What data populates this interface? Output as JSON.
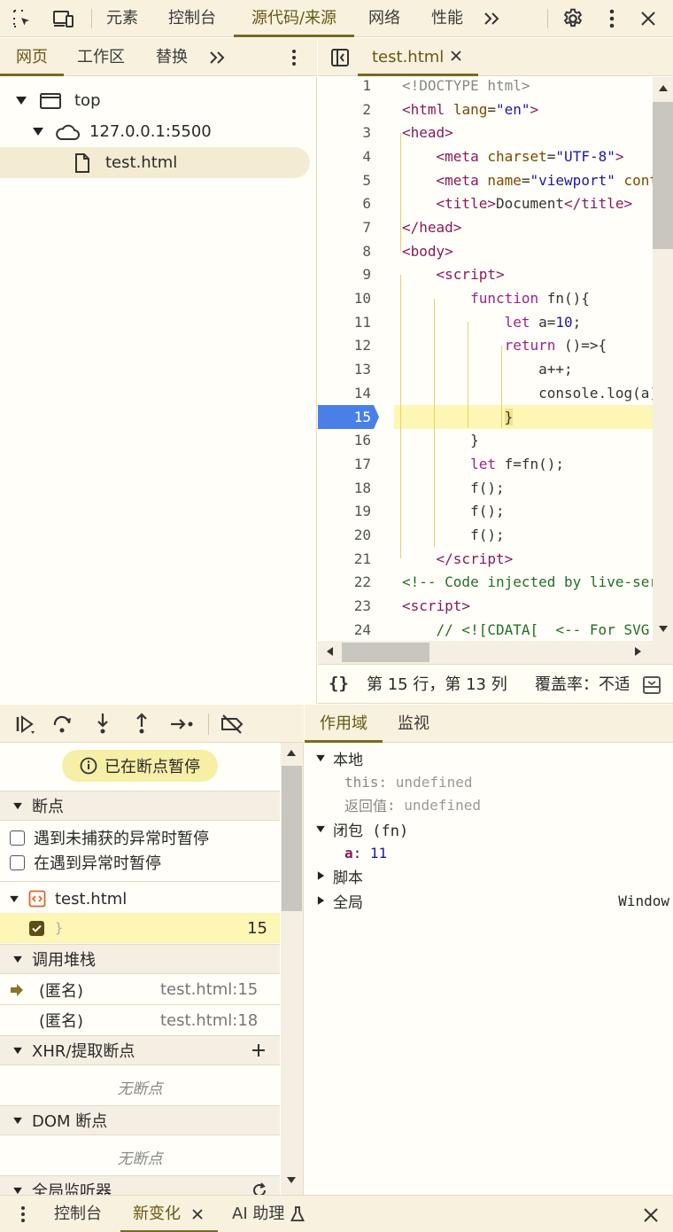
{
  "top_tabs": {
    "elements": "元素",
    "console": "控制台",
    "sources": "源代码/来源",
    "network": "网络",
    "performance": "性能"
  },
  "navigator": {
    "tabs": [
      "网页",
      "工作区",
      "替换"
    ],
    "tree": {
      "top": "top",
      "host": "127.0.0.1:5500",
      "file": "test.html"
    }
  },
  "editor": {
    "tab_label": "test.html",
    "lines": [
      {
        "n": "1"
      },
      {
        "n": "2"
      },
      {
        "n": "3"
      },
      {
        "n": "4"
      },
      {
        "n": "5"
      },
      {
        "n": "6"
      },
      {
        "n": "7"
      },
      {
        "n": "8"
      },
      {
        "n": "9"
      },
      {
        "n": "10"
      },
      {
        "n": "11"
      },
      {
        "n": "12"
      },
      {
        "n": "13"
      },
      {
        "n": "14"
      },
      {
        "n": "15"
      },
      {
        "n": "16"
      },
      {
        "n": "17"
      },
      {
        "n": "18"
      },
      {
        "n": "19"
      },
      {
        "n": "20"
      },
      {
        "n": "21"
      },
      {
        "n": "22"
      },
      {
        "n": "23"
      },
      {
        "n": "24"
      }
    ],
    "paused_line": "15",
    "status_position": "第 15 行，第 13 列",
    "status_coverage": "覆盖率：不适"
  },
  "debugger": {
    "paused_badge": "已在断点暂停",
    "breakpoints_header": "断点",
    "pause_uncaught": "遇到未捕获的异常时暂停",
    "pause_caught": "在遇到异常时暂停",
    "bp_file": "test.html",
    "bp_snippet": "}",
    "bp_line": "15",
    "callstack_header": "调用堆栈",
    "callstack": [
      {
        "name": "(匿名)",
        "loc": "test.html:15"
      },
      {
        "name": "(匿名)",
        "loc": "test.html:18"
      }
    ],
    "xhr_header": "XHR/提取断点",
    "xhr_empty": "无断点",
    "dom_header": "DOM 断点",
    "dom_empty": "无断点",
    "listeners_header": "全局监听器"
  },
  "scope": {
    "tabs": [
      "作用域",
      "监视"
    ],
    "local": "本地",
    "this_key": "this",
    "this_val": "undefined",
    "ret_key": "返回值",
    "ret_val": "undefined",
    "closure": "闭包 (fn)",
    "a_key": "a",
    "a_val": "11",
    "script": "脚本",
    "global": "全局",
    "global_val": "Window"
  },
  "drawer": {
    "console": "控制台",
    "whats_new": "新变化",
    "ai": "AI 助理"
  }
}
